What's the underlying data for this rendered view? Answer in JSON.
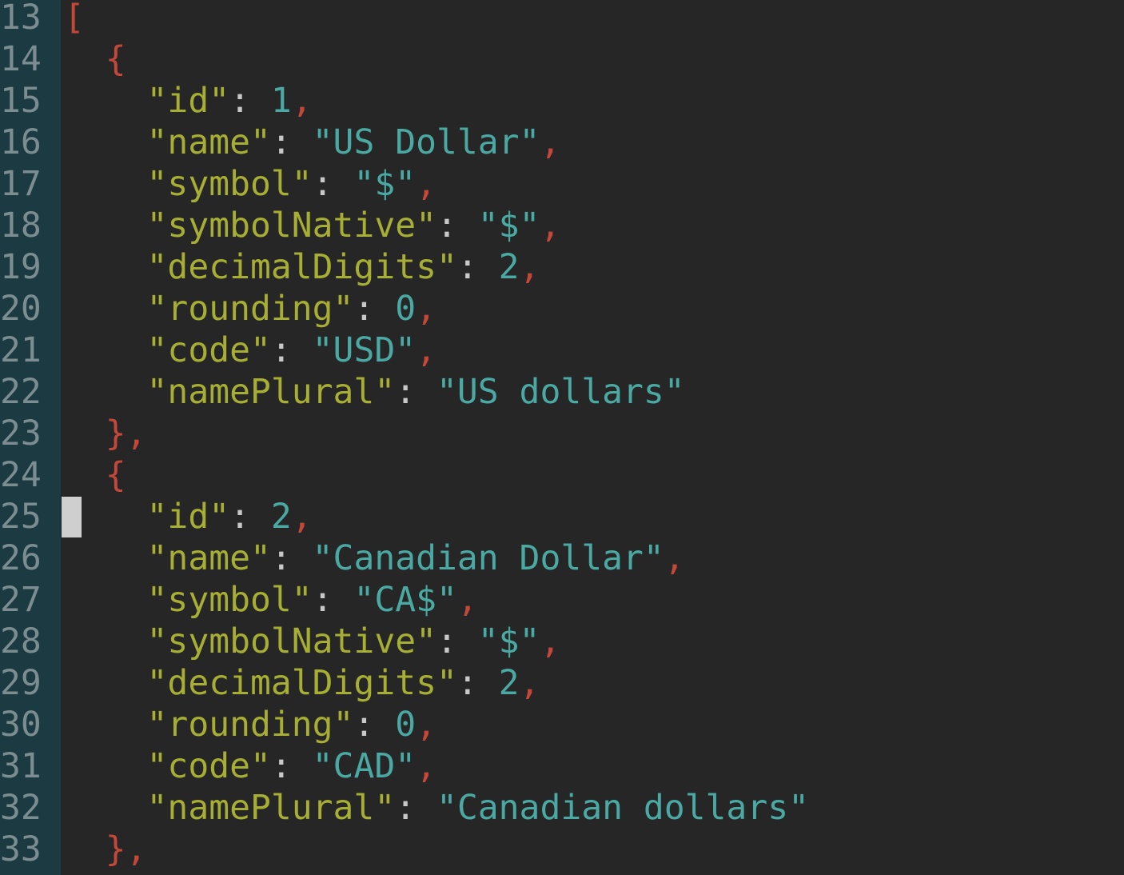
{
  "editor": {
    "lines": [
      {
        "n": "13",
        "indent": 0,
        "tokens": [
          {
            "t": "[",
            "c": "punct"
          }
        ]
      },
      {
        "n": "14",
        "indent": 1,
        "tokens": [
          {
            "t": "{",
            "c": "punct"
          }
        ]
      },
      {
        "n": "15",
        "indent": 2,
        "tokens": [
          {
            "t": "\"id\"",
            "c": "key"
          },
          {
            "t": ": ",
            "c": "colon"
          },
          {
            "t": "1",
            "c": "num"
          },
          {
            "t": ",",
            "c": "punct"
          }
        ]
      },
      {
        "n": "16",
        "indent": 2,
        "tokens": [
          {
            "t": "\"name\"",
            "c": "key"
          },
          {
            "t": ": ",
            "c": "colon"
          },
          {
            "t": "\"US Dollar\"",
            "c": "str"
          },
          {
            "t": ",",
            "c": "punct"
          }
        ]
      },
      {
        "n": "17",
        "indent": 2,
        "tokens": [
          {
            "t": "\"symbol\"",
            "c": "key"
          },
          {
            "t": ": ",
            "c": "colon"
          },
          {
            "t": "\"$\"",
            "c": "str"
          },
          {
            "t": ",",
            "c": "punct"
          }
        ]
      },
      {
        "n": "18",
        "indent": 2,
        "tokens": [
          {
            "t": "\"symbolNative\"",
            "c": "key"
          },
          {
            "t": ": ",
            "c": "colon"
          },
          {
            "t": "\"$\"",
            "c": "str"
          },
          {
            "t": ",",
            "c": "punct"
          }
        ]
      },
      {
        "n": "19",
        "indent": 2,
        "tokens": [
          {
            "t": "\"decimalDigits\"",
            "c": "key"
          },
          {
            "t": ": ",
            "c": "colon"
          },
          {
            "t": "2",
            "c": "num"
          },
          {
            "t": ",",
            "c": "punct"
          }
        ]
      },
      {
        "n": "20",
        "indent": 2,
        "tokens": [
          {
            "t": "\"rounding\"",
            "c": "key"
          },
          {
            "t": ": ",
            "c": "colon"
          },
          {
            "t": "0",
            "c": "num"
          },
          {
            "t": ",",
            "c": "punct"
          }
        ]
      },
      {
        "n": "21",
        "indent": 2,
        "tokens": [
          {
            "t": "\"code\"",
            "c": "key"
          },
          {
            "t": ": ",
            "c": "colon"
          },
          {
            "t": "\"USD\"",
            "c": "str"
          },
          {
            "t": ",",
            "c": "punct"
          }
        ]
      },
      {
        "n": "22",
        "indent": 2,
        "tokens": [
          {
            "t": "\"namePlural\"",
            "c": "key"
          },
          {
            "t": ": ",
            "c": "colon"
          },
          {
            "t": "\"US dollars\"",
            "c": "str"
          }
        ]
      },
      {
        "n": "23",
        "indent": 1,
        "tokens": [
          {
            "t": "},",
            "c": "punct"
          }
        ]
      },
      {
        "n": "24",
        "indent": 1,
        "tokens": [
          {
            "t": "{",
            "c": "punct"
          }
        ]
      },
      {
        "n": "25",
        "indent": 2,
        "tokens": [
          {
            "t": "\"id\"",
            "c": "key"
          },
          {
            "t": ": ",
            "c": "colon"
          },
          {
            "t": "2",
            "c": "num"
          },
          {
            "t": ",",
            "c": "punct"
          }
        ]
      },
      {
        "n": "26",
        "indent": 2,
        "tokens": [
          {
            "t": "\"name\"",
            "c": "key"
          },
          {
            "t": ": ",
            "c": "colon"
          },
          {
            "t": "\"Canadian Dollar\"",
            "c": "str"
          },
          {
            "t": ",",
            "c": "punct"
          }
        ]
      },
      {
        "n": "27",
        "indent": 2,
        "tokens": [
          {
            "t": "\"symbol\"",
            "c": "key"
          },
          {
            "t": ": ",
            "c": "colon"
          },
          {
            "t": "\"CA$\"",
            "c": "str"
          },
          {
            "t": ",",
            "c": "punct"
          }
        ]
      },
      {
        "n": "28",
        "indent": 2,
        "tokens": [
          {
            "t": "\"symbolNative\"",
            "c": "key"
          },
          {
            "t": ": ",
            "c": "colon"
          },
          {
            "t": "\"$\"",
            "c": "str"
          },
          {
            "t": ",",
            "c": "punct"
          }
        ]
      },
      {
        "n": "29",
        "indent": 2,
        "tokens": [
          {
            "t": "\"decimalDigits\"",
            "c": "key"
          },
          {
            "t": ": ",
            "c": "colon"
          },
          {
            "t": "2",
            "c": "num"
          },
          {
            "t": ",",
            "c": "punct"
          }
        ]
      },
      {
        "n": "30",
        "indent": 2,
        "tokens": [
          {
            "t": "\"rounding\"",
            "c": "key"
          },
          {
            "t": ": ",
            "c": "colon"
          },
          {
            "t": "0",
            "c": "num"
          },
          {
            "t": ",",
            "c": "punct"
          }
        ]
      },
      {
        "n": "31",
        "indent": 2,
        "tokens": [
          {
            "t": "\"code\"",
            "c": "key"
          },
          {
            "t": ": ",
            "c": "colon"
          },
          {
            "t": "\"CAD\"",
            "c": "str"
          },
          {
            "t": ",",
            "c": "punct"
          }
        ]
      },
      {
        "n": "32",
        "indent": 2,
        "tokens": [
          {
            "t": "\"namePlural\"",
            "c": "key"
          },
          {
            "t": ": ",
            "c": "colon"
          },
          {
            "t": "\"Canadian dollars\"",
            "c": "str"
          }
        ]
      },
      {
        "n": "33",
        "indent": 1,
        "tokens": [
          {
            "t": "},",
            "c": "punct"
          }
        ]
      }
    ]
  },
  "colors": {
    "background": "#262626",
    "gutter": "#1b3a42",
    "line_number": "#7b8d91",
    "key": "#a6ae33",
    "string": "#4aa9a3",
    "number": "#4aa9a3",
    "punctuation": "#c4483a",
    "colon": "#c8c8c8",
    "cursor": "#cfcfcf"
  },
  "cursor_line": "25"
}
